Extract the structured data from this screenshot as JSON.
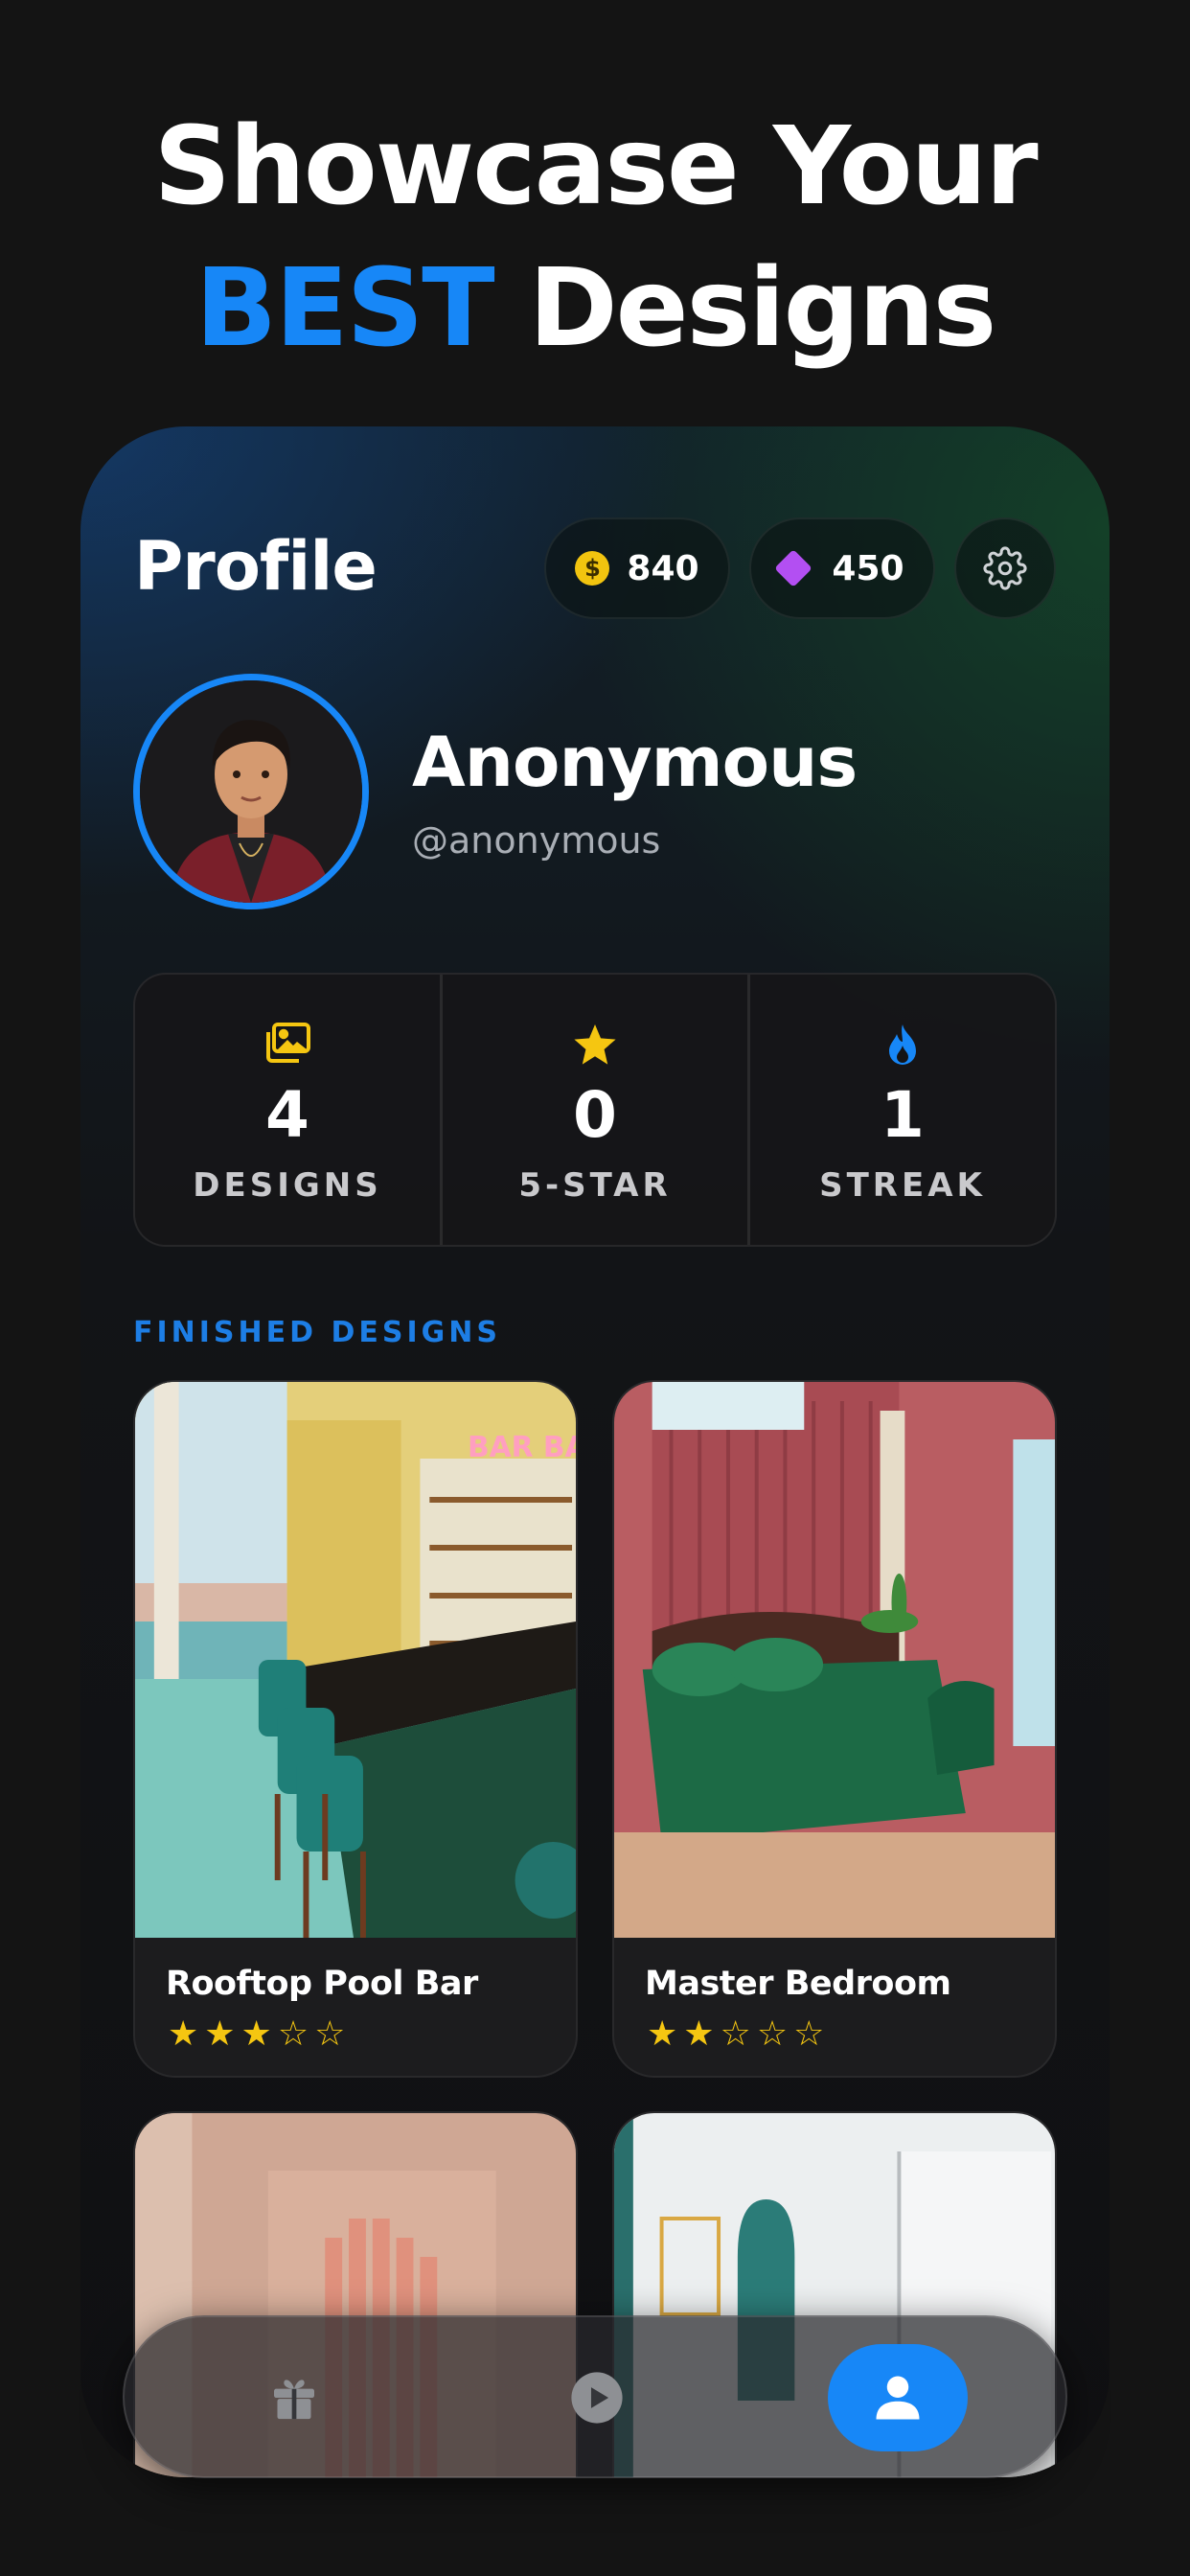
{
  "headline": {
    "line1": "Showcase Your",
    "accent": "BEST",
    "line2_rest": "Designs"
  },
  "profile": {
    "title": "Profile",
    "coins": "840",
    "gems": "450",
    "name": "Anonymous",
    "handle": "@anonymous"
  },
  "stats": [
    {
      "value": "4",
      "label": "DESIGNS",
      "icon": "images-icon",
      "color": "#f5c611"
    },
    {
      "value": "0",
      "label": "5-STAR",
      "icon": "star-icon",
      "color": "#f5c611"
    },
    {
      "value": "1",
      "label": "STREAK",
      "icon": "flame-icon",
      "color": "#1787f7"
    }
  ],
  "section": {
    "finished_label": "FINISHED DESIGNS"
  },
  "designs": [
    {
      "title": "Rooftop Pool Bar",
      "rating": 3,
      "stars": "★★★☆☆"
    },
    {
      "title": "Master Bedroom",
      "rating": 2,
      "stars": "★★☆☆☆"
    },
    {
      "title": "",
      "rating": null
    },
    {
      "title": "",
      "rating": null
    }
  ],
  "tabbar": {
    "active": "profile",
    "tabs": [
      "gift-icon",
      "play-icon",
      "person-icon"
    ]
  },
  "colors": {
    "accent": "#1787f7",
    "star": "#f5c611",
    "gem": "#b34ff2",
    "coin": "#f2c40f"
  }
}
